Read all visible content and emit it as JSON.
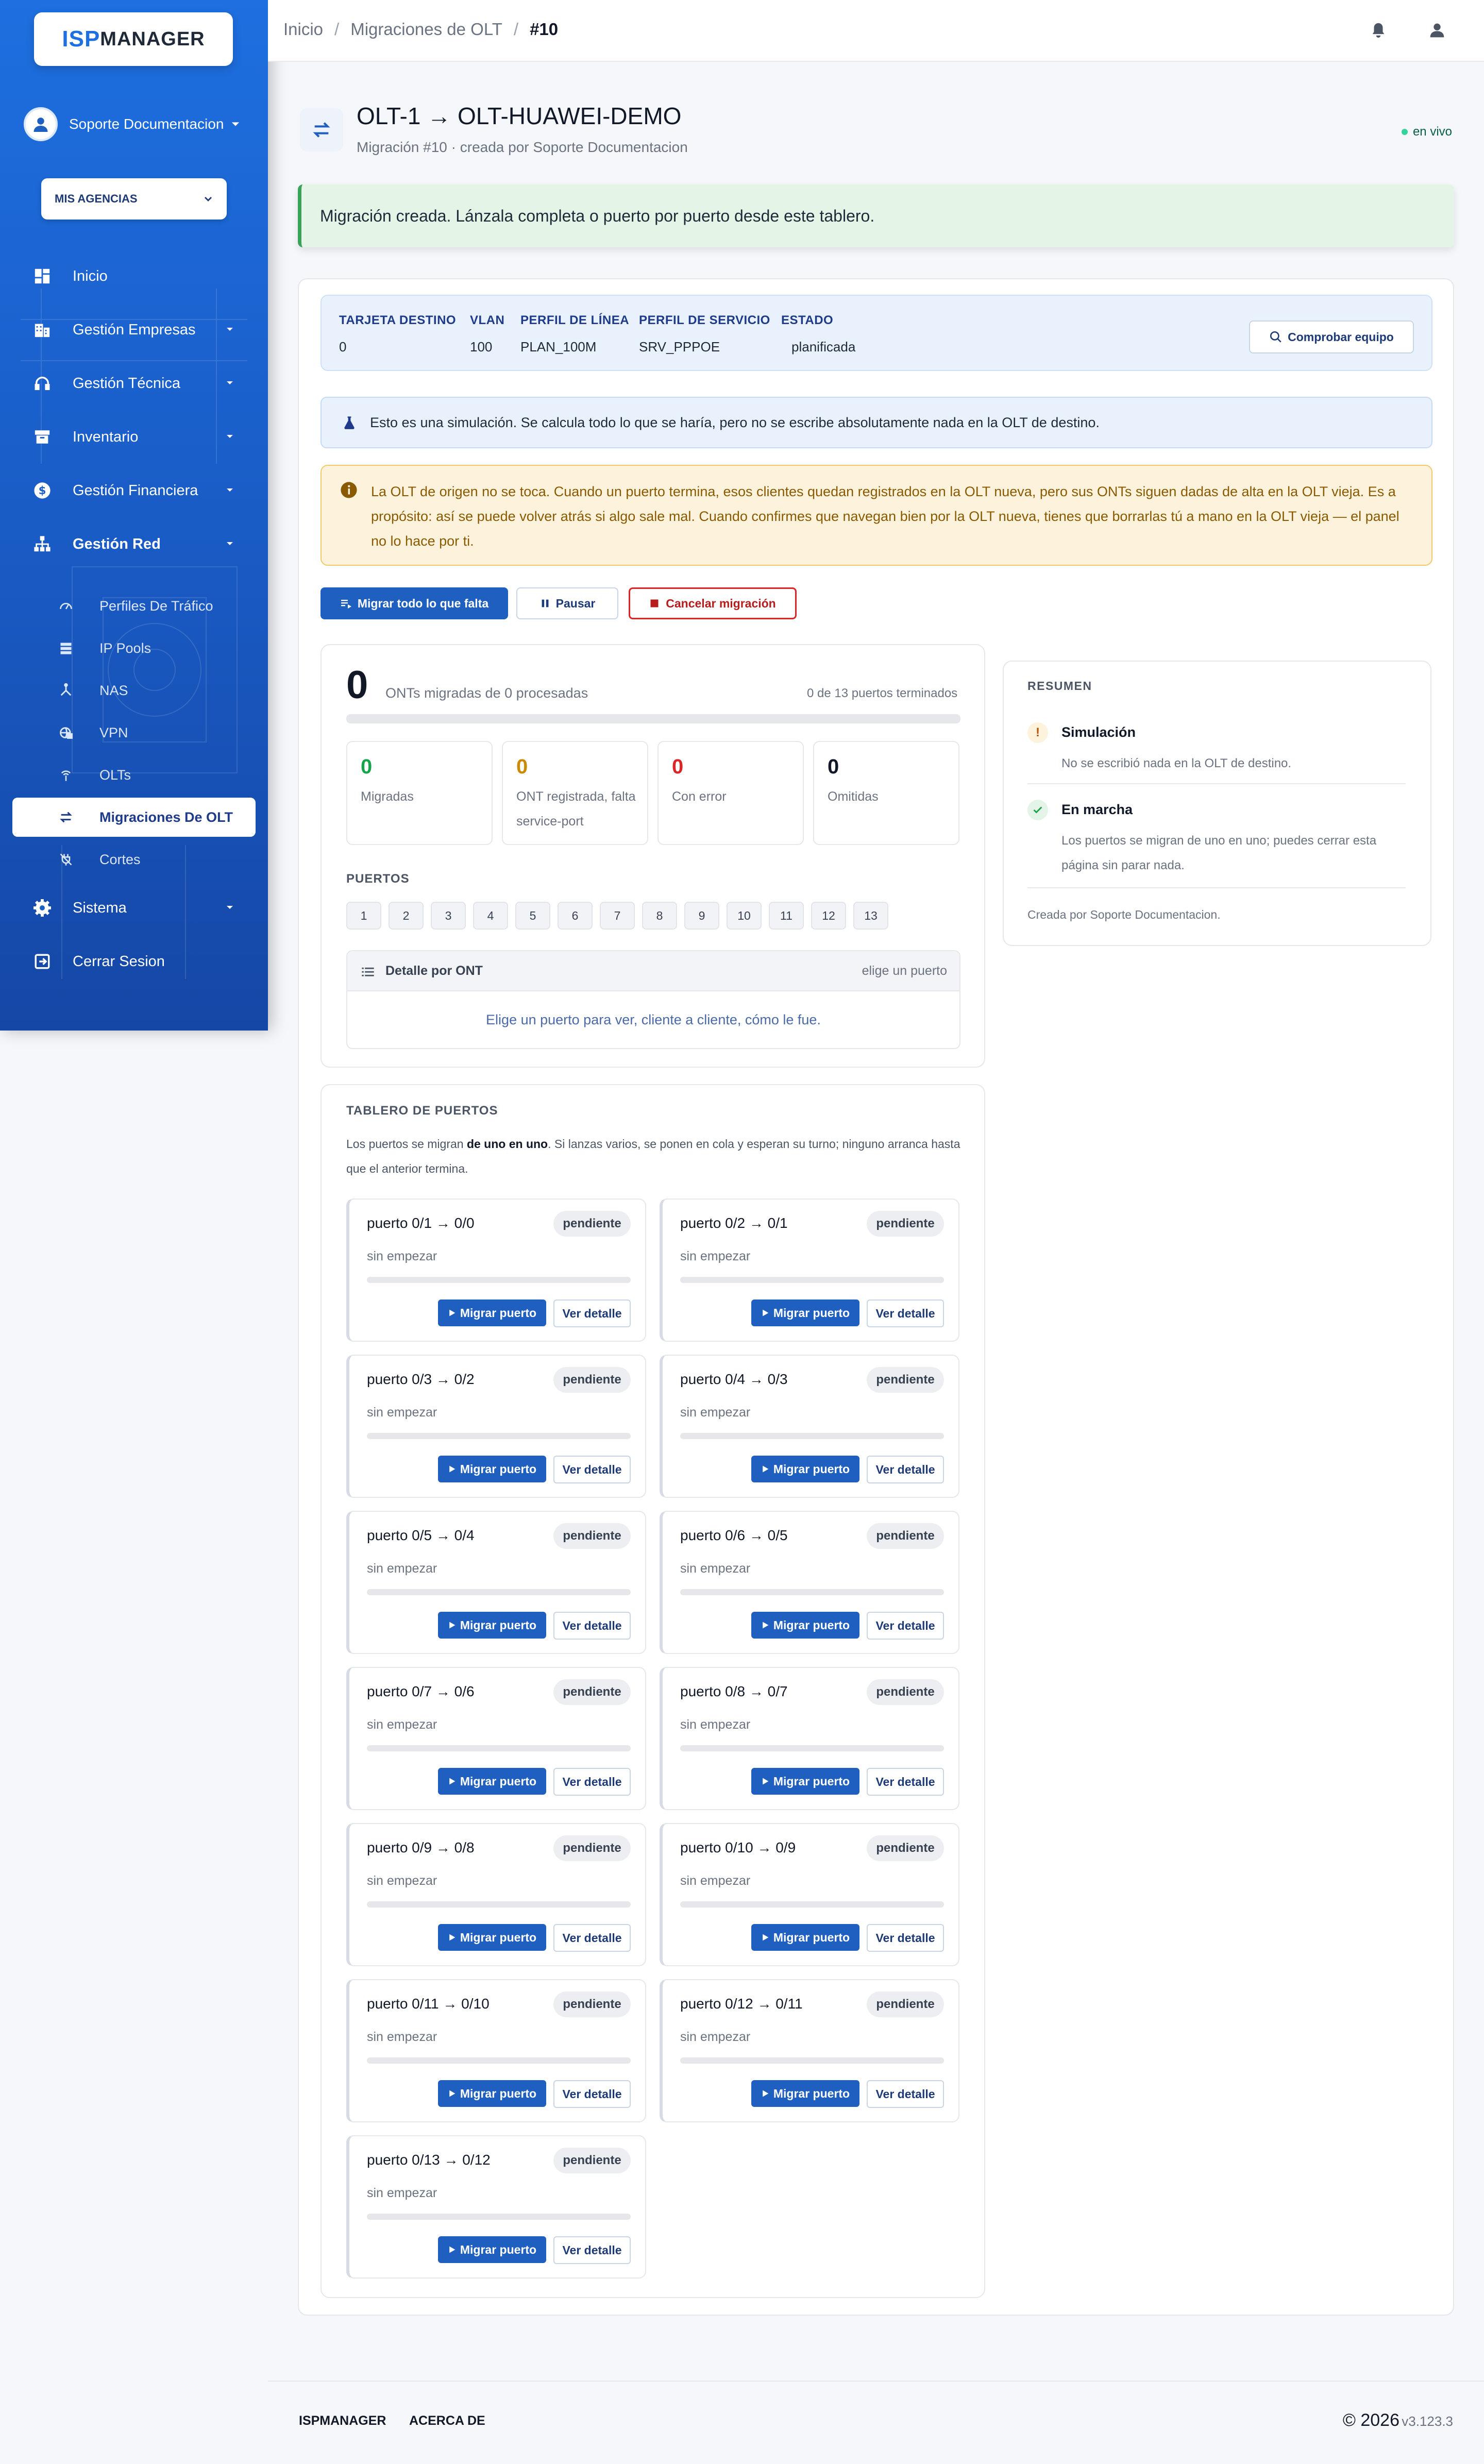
{
  "sidebar": {
    "logo_isp": "ISP",
    "logo_manager": "MANAGER",
    "user_name": "Soporte Documentacion",
    "agency_label": "MIS AGENCIAS",
    "nav": [
      {
        "label": "Inicio",
        "icon": "dashboard-icon"
      },
      {
        "label": "Gestión Empresas",
        "icon": "building-icon"
      },
      {
        "label": "Gestión Técnica",
        "icon": "headset-icon"
      },
      {
        "label": "Inventario",
        "icon": "box-icon"
      },
      {
        "label": "Gestión Financiera",
        "icon": "dollar-icon"
      },
      {
        "label": "Gestión Red",
        "icon": "network-icon"
      }
    ],
    "sub": [
      {
        "label": "Perfiles De Tráfico",
        "icon": "gauge-icon"
      },
      {
        "label": "IP Pools",
        "icon": "server-icon"
      },
      {
        "label": "NAS",
        "icon": "hub-icon"
      },
      {
        "label": "VPN",
        "icon": "vpn-icon"
      },
      {
        "label": "OLTs",
        "icon": "antenna-icon"
      },
      {
        "label": "Migraciones De OLT",
        "icon": "swap-icon"
      },
      {
        "label": "Cortes",
        "icon": "plug-off-icon"
      }
    ],
    "sistema": "Sistema",
    "logout": "Cerrar Sesion"
  },
  "breadcrumb": {
    "home": "Inicio",
    "section": "Migraciones de OLT",
    "current": "#10",
    "sep": "/"
  },
  "header": {
    "title": "OLT-1 → OLT-HUAWEI-DEMO",
    "subtitle": "Migración #10 · creada por Soporte Documentacion",
    "live": "en vivo"
  },
  "flash": "Migración creada. Lánzala completa o puerto por puerto desde este tablero.",
  "info": {
    "cols": [
      {
        "h": "TARJETA DESTINO",
        "v": "0"
      },
      {
        "h": "VLAN",
        "v": "100"
      },
      {
        "h": "PERFIL DE LÍNEA",
        "v": "PLAN_100M"
      },
      {
        "h": "PERFIL DE SERVICIO",
        "v": "SRV_PPPOE"
      },
      {
        "h": "ESTADO",
        "v": "planificada"
      }
    ],
    "check_btn": "Comprobar equipo"
  },
  "sim_notice": "Esto es una simulación. Se calcula todo lo que se haría, pero no se escribe absolutamente nada en la OLT de destino.",
  "warning_notice": "La OLT de origen no se toca. Cuando un puerto termina, esos clientes quedan registrados en la OLT nueva, pero sus ONTs siguen dadas de alta en la OLT vieja. Es a propósito: así se puede volver atrás si algo sale mal. Cuando confirmes que navegan bien por la OLT nueva, tienes que borrarlas tú a mano en la OLT vieja — el panel no lo hace por ti.",
  "actions": {
    "migrate_all": "Migrar todo lo que falta",
    "pause": "Pausar",
    "cancel": "Cancelar migración"
  },
  "stats": {
    "migrated_count": "0",
    "migrated_text": "ONTs migradas de 0 procesadas",
    "ports_done": "0 de 13 puertos terminados",
    "progress": 0,
    "boxes": [
      {
        "n": "0",
        "label": "Migradas",
        "color": "#16a34a"
      },
      {
        "n": "0",
        "label": "ONT registrada, falta service-port",
        "color": "#ca8a04"
      },
      {
        "n": "0",
        "label": "Con error",
        "color": "#dc2626"
      },
      {
        "n": "0",
        "label": "Omitidas",
        "color": "#111827"
      }
    ]
  },
  "ports_section": {
    "title": "PUERTOS",
    "chips": [
      "1",
      "2",
      "3",
      "4",
      "5",
      "6",
      "7",
      "8",
      "9",
      "10",
      "11",
      "12",
      "13"
    ],
    "detail_title": "Detalle por ONT",
    "detail_hint": "elige un puerto",
    "detail_empty": "Elige un puerto para ver, cliente a cliente, cómo le fue."
  },
  "summary": {
    "title": "RESUMEN",
    "items": [
      {
        "title": "Simulación",
        "desc": "No se escribió nada en la OLT de destino."
      },
      {
        "title": "En marcha",
        "desc": "Los puertos se migran de uno en uno; puedes cerrar esta página sin parar nada."
      }
    ],
    "footer": "Creada por Soporte Documentacion."
  },
  "board": {
    "title": "TABLERO DE PUERTOS",
    "desc_pre": "Los puertos se migran ",
    "desc_bold": "de uno en uno",
    "desc_post": ". Si lanzas varios, se ponen en cola y esperan su turno; ninguno arranca hasta que el anterior termina.",
    "status": "pendiente",
    "sub": "sin empezar",
    "migrate_btn": "Migrar puerto",
    "detail_btn": "Ver detalle",
    "ports": [
      "puerto 0/1 → 0/0",
      "puerto 0/2 → 0/1",
      "puerto 0/3 → 0/2",
      "puerto 0/4 → 0/3",
      "puerto 0/5 → 0/4",
      "puerto 0/6 → 0/5",
      "puerto 0/7 → 0/6",
      "puerto 0/8 → 0/7",
      "puerto 0/9 → 0/8",
      "puerto 0/10 → 0/9",
      "puerto 0/11 → 0/10",
      "puerto 0/12 → 0/11",
      "puerto 0/13 → 0/12"
    ]
  },
  "footer": {
    "link1": "ISPMANAGER",
    "link2": "ACERCA DE",
    "copyright": "© 2026",
    "version": "v3.123.3"
  },
  "colors": {
    "primary": "#1f5fc0",
    "sidebar": "#1a5ec9",
    "success": "#3aa35a",
    "warning": "#f0c96b",
    "danger": "#dc2626"
  }
}
